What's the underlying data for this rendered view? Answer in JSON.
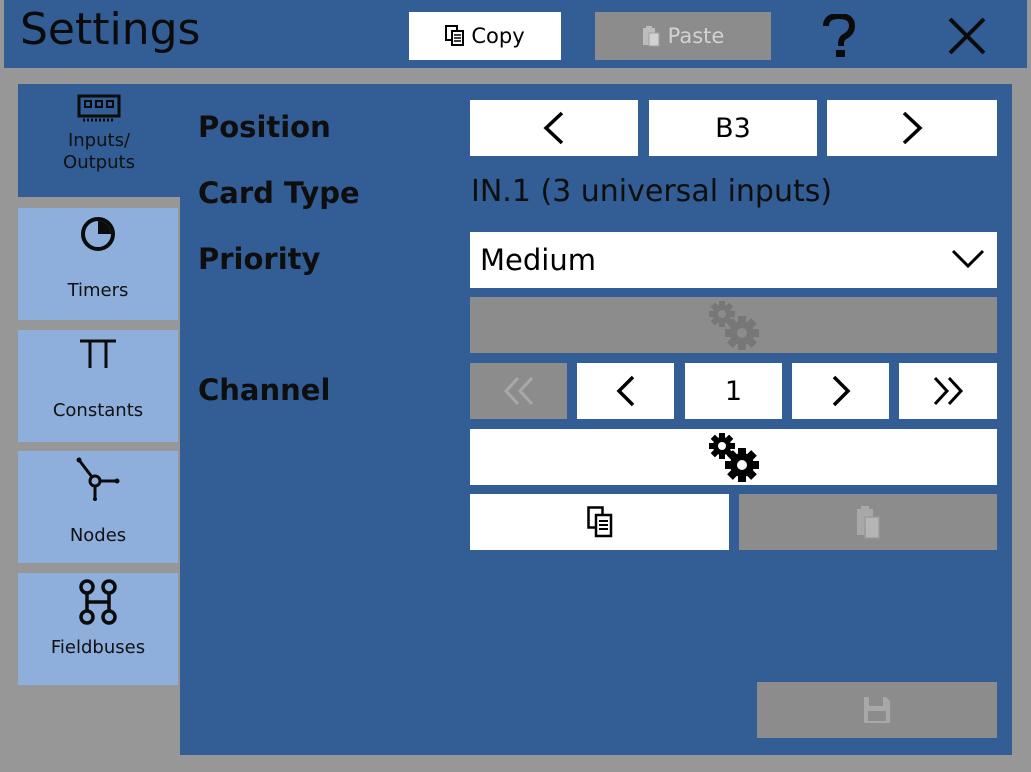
{
  "header": {
    "title": "Settings",
    "copy_label": "Copy",
    "paste_label": "Paste"
  },
  "sidebar": {
    "items": [
      {
        "label": "Inputs/\nOutputs",
        "icon": "io-card-icon",
        "active": true
      },
      {
        "label": "Timers",
        "icon": "timer-icon",
        "active": false
      },
      {
        "label": "Constants",
        "icon": "pi-icon",
        "active": false
      },
      {
        "label": "Nodes",
        "icon": "node-icon",
        "active": false
      },
      {
        "label": "Fieldbuses",
        "icon": "fieldbus-icon",
        "active": false
      }
    ]
  },
  "form": {
    "position_label": "Position",
    "position_value": "B3",
    "card_type_label": "Card Type",
    "card_type_value": "IN.1 (3 universal inputs)",
    "priority_label": "Priority",
    "priority_value": "Medium",
    "channel_label": "Channel",
    "channel_value": "1"
  },
  "colors": {
    "accent": "#325d95",
    "tab_inactive": "#8eaedb",
    "disabled": "#8c8c8c",
    "background": "#979797"
  }
}
